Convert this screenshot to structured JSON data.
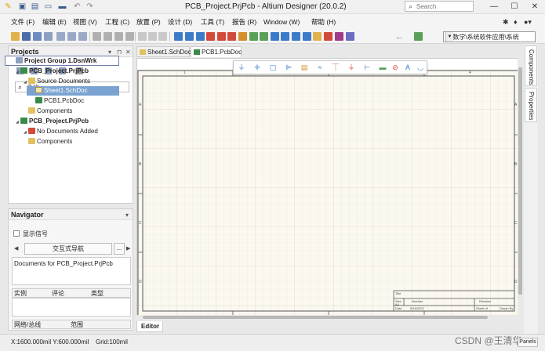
{
  "window": {
    "title": "PCB_Project.PrjPcb - Altium Designer (20.0.2)",
    "search_placeholder": "Search",
    "minimize": "—",
    "maximize": "☐",
    "close": "✕"
  },
  "menu": {
    "items": [
      "文件 (F)",
      "编辑 (E)",
      "视图 (V)",
      "工程 (C)",
      "放置 (P)",
      "设计 (D)",
      "工具 (T)",
      "报告 (R)",
      "Window (W)",
      "帮助 (H)"
    ]
  },
  "toolbar": {
    "more": "...",
    "path_value": "F:\\数学\\系统软件应用\\系统"
  },
  "projects_panel": {
    "title": "Projects",
    "search_placeholder": "查找",
    "tree": {
      "group": "Project Group 1.DsnWrk",
      "project1": "PCB_Project.PrjPcb",
      "source_docs": "Source Documents",
      "sheet1": "Sheet1.SchDoc",
      "pcb1": "PCB1.PcbDoc",
      "components1": "Components",
      "project2": "PCB_Project.PrjPcb",
      "no_docs": "No Documents Added",
      "components2": "Components"
    }
  },
  "navigator": {
    "title": "Navigator",
    "show_signals": "显示信号",
    "mode_button": "交互式导航",
    "more_button": "...",
    "documents_for": "Documents for PCB_Project.PrjPcb",
    "col_instance": "实例",
    "col_comment": "评论",
    "col_type": "类型",
    "col_net": "网络/总线",
    "col_scope": "范围"
  },
  "doc_tabs": {
    "sch": "Sheet1.SchDoc",
    "pcb": "PCB1.PcbDoc"
  },
  "sheet": {
    "ruler_h": [
      "1",
      "2",
      "3",
      "4"
    ],
    "ruler_v": [
      "A",
      "B",
      "C",
      "D"
    ],
    "title_block": {
      "title": "Title",
      "size": "Size",
      "number": "Number",
      "revision": "Revision",
      "size_value": "A4",
      "date": "Date",
      "date_value": "5/18/2022",
      "sheet_of": "Sheet of",
      "file": "File",
      "drawn_by": "Drawn By"
    }
  },
  "right_tabs": {
    "components": "Components",
    "properties": "Properties"
  },
  "editor_tab": "Editor",
  "status": {
    "coords": "X:1600.000mil Y:600.000mil",
    "grid": "Grid:100mil",
    "panels": "Panels"
  },
  "watermark": "CSDN @王清华"
}
